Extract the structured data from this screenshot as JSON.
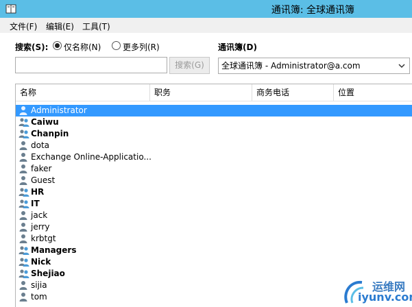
{
  "window": {
    "title": "通讯簿: 全球通讯簿"
  },
  "menu": [
    "文件(F)",
    "编辑(E)",
    "工具(T)"
  ],
  "search": {
    "label": "搜索(S):",
    "options": [
      {
        "label": "仅名称(N)",
        "checked": true
      },
      {
        "label": "更多列(R)",
        "checked": false
      }
    ],
    "input_value": "",
    "button_label": "搜索(G)"
  },
  "address_book": {
    "label": "通讯簿(D)",
    "selected": "全球通讯簿 - Administrator@a.com"
  },
  "columns": [
    "名称",
    "职务",
    "商务电话",
    "位置"
  ],
  "rows": [
    {
      "name": "Administrator",
      "type": "user",
      "selected": true
    },
    {
      "name": "Caiwu",
      "type": "group"
    },
    {
      "name": "Chanpin",
      "type": "group"
    },
    {
      "name": "dota",
      "type": "user"
    },
    {
      "name": "Exchange Online-Applicatio...",
      "type": "user"
    },
    {
      "name": "faker",
      "type": "user"
    },
    {
      "name": "Guest",
      "type": "user"
    },
    {
      "name": "HR",
      "type": "group"
    },
    {
      "name": "IT",
      "type": "group"
    },
    {
      "name": "jack",
      "type": "user"
    },
    {
      "name": "jerry",
      "type": "user"
    },
    {
      "name": "krbtgt",
      "type": "user"
    },
    {
      "name": "Managers",
      "type": "group"
    },
    {
      "name": "Nick",
      "type": "group"
    },
    {
      "name": "Shejiao",
      "type": "group"
    },
    {
      "name": "sijia",
      "type": "user"
    },
    {
      "name": "tom",
      "type": "user"
    }
  ],
  "watermark": {
    "cn": "运维网",
    "en": "iyunv.com"
  },
  "colors": {
    "titlebar": "#5bbee6",
    "selection": "#3399ff",
    "icon": "#6b7f8f"
  }
}
